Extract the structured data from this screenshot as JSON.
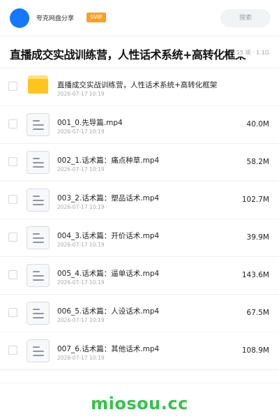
{
  "header": {
    "share_name": "夸克网盘分享",
    "vip_badge": "SVIP",
    "search_placeholder": "搜索"
  },
  "title_bar": {
    "title": "直播成交实战训练营，人性话术系统+高转化框架",
    "meta": "15 项 · 1.1G"
  },
  "files": [
    {
      "type": "folder",
      "name": "直播成交实战训练营，人性话术系统+高转化框架",
      "date": "2026-07-17 10:19",
      "size": ""
    },
    {
      "type": "file",
      "name": "001_0.先导篇.mp4",
      "date": "2026-07-17 10:19",
      "size": "40.0M"
    },
    {
      "type": "file",
      "name": "002_1.话术篇：痛点种草.mp4",
      "date": "2026-07-17 10:19",
      "size": "58.2M"
    },
    {
      "type": "file",
      "name": "003_2.话术篇：塑品话术.mp4",
      "date": "2026-07-17 10:19",
      "size": "102.7M"
    },
    {
      "type": "file",
      "name": "004_3.话术篇：开价话术.mp4",
      "date": "2026-07-17 10:19",
      "size": "39.9M"
    },
    {
      "type": "file",
      "name": "005_4.话术篇：逼单话术.mp4",
      "date": "2026-07-17 10:19",
      "size": "143.6M"
    },
    {
      "type": "file",
      "name": "006_5.话术篇：人设话术.mp4",
      "date": "2026-07-17 10:19",
      "size": "67.5M"
    },
    {
      "type": "file",
      "name": "007_6.话术篇：其他话术.mp4",
      "date": "2026-07-17 10:19",
      "size": "108.9M"
    }
  ],
  "watermark": "miosou.cc",
  "colors": {
    "avatar": "#1677ff",
    "vip": "#f7a02a",
    "folder": "#ffc51b",
    "watermark": "#37c24c"
  }
}
